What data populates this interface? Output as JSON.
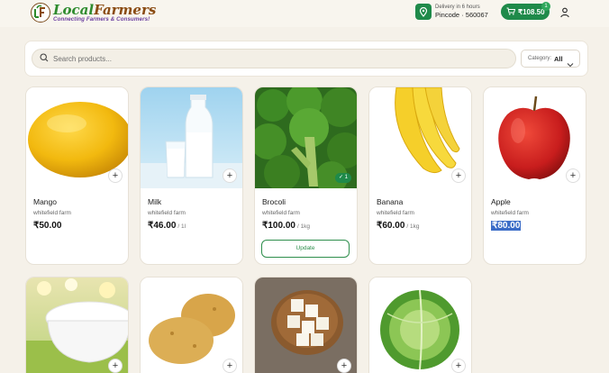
{
  "header": {
    "logo_title_part1": "Local",
    "logo_title_part2": "Farmers",
    "logo_tagline": "Connecting Farmers & Consumers!",
    "delivery_line": "Delivery in 6 hours",
    "pincode_label": "Pincode · 560067",
    "cart_amount": "₹108.50",
    "cart_count": "1"
  },
  "search": {
    "placeholder": "Search products..."
  },
  "category": {
    "label": "Category:",
    "value": "All"
  },
  "products": [
    {
      "name": "Mango",
      "farm": "whitefield farm",
      "price": "₹50.00",
      "unit": ""
    },
    {
      "name": "Milk",
      "farm": "whitefield farm",
      "price": "₹46.00",
      "unit": "/ 1l"
    },
    {
      "name": "Brocoli",
      "farm": "whitefield farm",
      "price": "₹100.00",
      "unit": "/ 1kg",
      "in_cart": "✓ 1",
      "update_label": "Update"
    },
    {
      "name": "Banana",
      "farm": "whitefield farm",
      "price": "₹60.00",
      "unit": "/ 1kg"
    },
    {
      "name": "Apple",
      "farm": "whitefield farm",
      "price": "₹80.00",
      "unit": ""
    }
  ],
  "icons": {
    "search": "search-icon",
    "location": "location-pin-icon",
    "cart": "cart-icon",
    "user": "user-icon",
    "chevron": "chevron-down-icon",
    "add": "plus-icon"
  },
  "colors": {
    "brand_green": "#1f8a4a",
    "background": "#f5f1e9",
    "highlight": "#3b6cc7"
  }
}
